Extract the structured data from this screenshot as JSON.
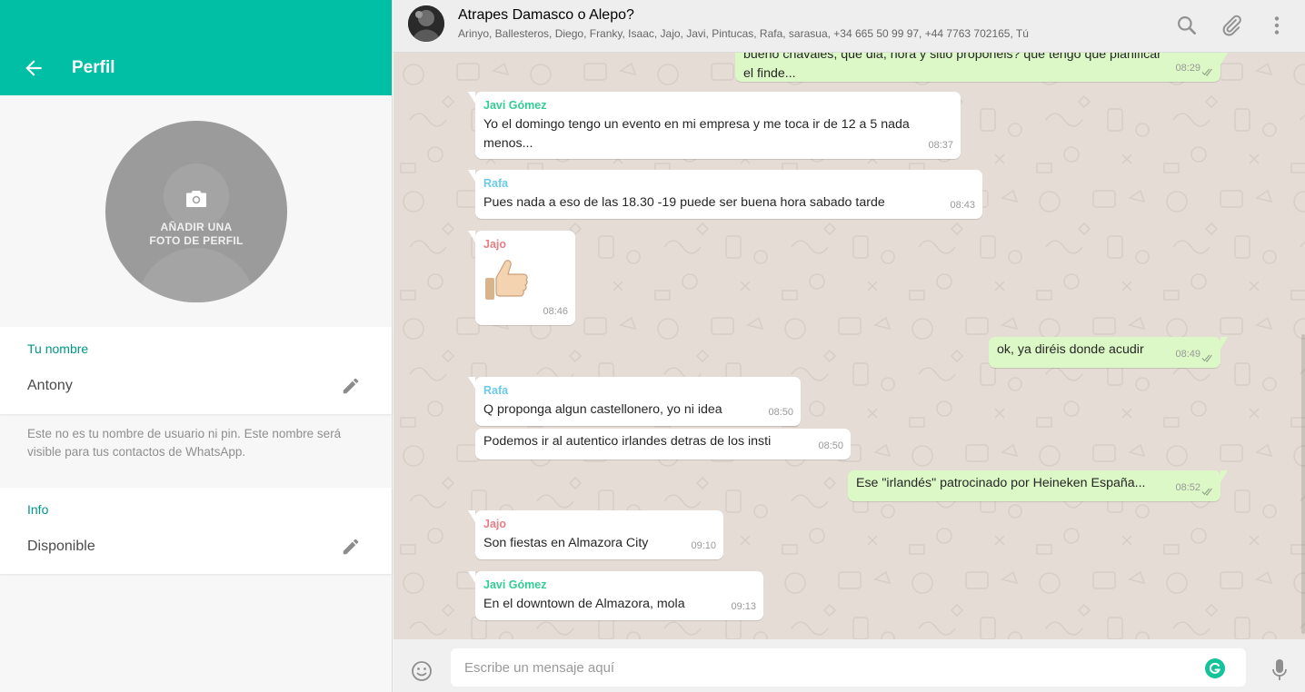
{
  "profile": {
    "title": "Perfil",
    "photo_label_line1": "AÑADIR UNA",
    "photo_label_line2": "FOTO DE PERFIL",
    "name_label": "Tu nombre",
    "name_value": "Antony",
    "name_hint": "Este no es tu nombre de usuario ni pin. Este nombre será visible para tus contactos de WhatsApp.",
    "info_label": "Info",
    "info_value": "Disponible"
  },
  "chat": {
    "title": "Atrapes Damasco o Alepo?",
    "members": "Arinyo, Ballesteros, Diego, Franky, Isaac, Jajo, Javi, Pintucas, Rafa, sarasua, +34 665 50 99 97, +44 7763 702165, Tú",
    "messages": [
      {
        "type": "out",
        "text": "bueno chavales, que dia, hora y sitio proponeis? que tengo que planificar el finde...",
        "time": "08:29"
      },
      {
        "type": "in",
        "sender": "Javi Gómez",
        "sender_color": "#35cd96",
        "text": "Yo el domingo tengo un evento en mi empresa y me toca ir de 12 a 5 nada menos...",
        "time": "08:37"
      },
      {
        "type": "in",
        "sender": "Rafa",
        "sender_color": "#6bcbef",
        "text": "Pues nada a eso de las 18.30 -19 puede ser buena hora sabado tarde",
        "time": "08:43"
      },
      {
        "type": "in",
        "sender": "Jajo",
        "sender_color": "#e67f86",
        "text": "",
        "emoji": "thumbs-up",
        "time": "08:46"
      },
      {
        "type": "out",
        "text": "ok, ya diréis donde acudir",
        "time": "08:49"
      },
      {
        "type": "in",
        "sender": "Rafa",
        "sender_color": "#6bcbef",
        "text": "Q proponga algun castellonero, yo ni idea",
        "time": "08:50"
      },
      {
        "type": "in",
        "text": "Podemos ir al autentico irlandes detras de los insti",
        "time": "08:50"
      },
      {
        "type": "out",
        "text": "Ese \"irlandés\" patrocinado por Heineken España...",
        "time": "08:52"
      },
      {
        "type": "in",
        "sender": "Jajo",
        "sender_color": "#e67f86",
        "text": "Son fiestas en Almazora City",
        "time": "09:10"
      },
      {
        "type": "in",
        "sender": "Javi Gómez",
        "sender_color": "#35cd96",
        "text": "En el downtown de Almazora, mola",
        "time": "09:13"
      }
    ]
  },
  "composer": {
    "placeholder": "Escribe un mensaje aquí"
  },
  "colors": {
    "teal_header": "#00bfa5",
    "label_teal": "#009688",
    "out_bubble": "#dcf8c6",
    "chat_bg": "#e5ddd5",
    "read_ticks": "#4fc3f7"
  },
  "icons": [
    "back-arrow-icon",
    "camera-icon",
    "pencil-icon",
    "search-icon",
    "paperclip-icon",
    "menu-dots-icon",
    "emoji-icon",
    "grammarly-icon",
    "microphone-icon",
    "double-check-icon"
  ]
}
